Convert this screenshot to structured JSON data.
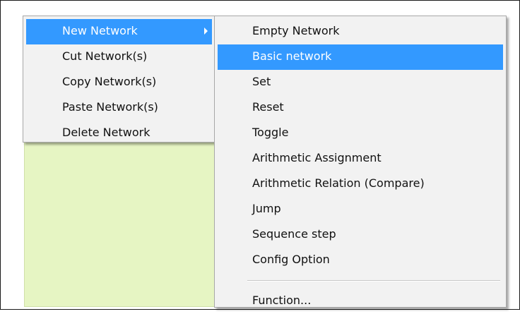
{
  "context_menu": {
    "items": [
      {
        "label": "New Network",
        "selected": true,
        "has_submenu": true
      },
      {
        "label": "Cut Network(s)"
      },
      {
        "label": "Copy Network(s)"
      },
      {
        "label": "Paste Network(s)"
      },
      {
        "label": "Delete Network"
      }
    ]
  },
  "submenu": {
    "items": [
      {
        "label": "Empty Network"
      },
      {
        "label": "Basic network",
        "selected": true
      },
      {
        "label": "Set"
      },
      {
        "label": "Reset"
      },
      {
        "label": "Toggle"
      },
      {
        "label": "Arithmetic Assignment"
      },
      {
        "label": "Arithmetic Relation (Compare)"
      },
      {
        "label": "Jump"
      },
      {
        "label": "Sequence step"
      },
      {
        "label": "Config Option"
      }
    ],
    "footer_item": {
      "label": "Function..."
    }
  },
  "colors": {
    "canvas_background": "#e6f5c3",
    "highlight": "#3399ff",
    "menu_background": "#f2f2f2"
  }
}
